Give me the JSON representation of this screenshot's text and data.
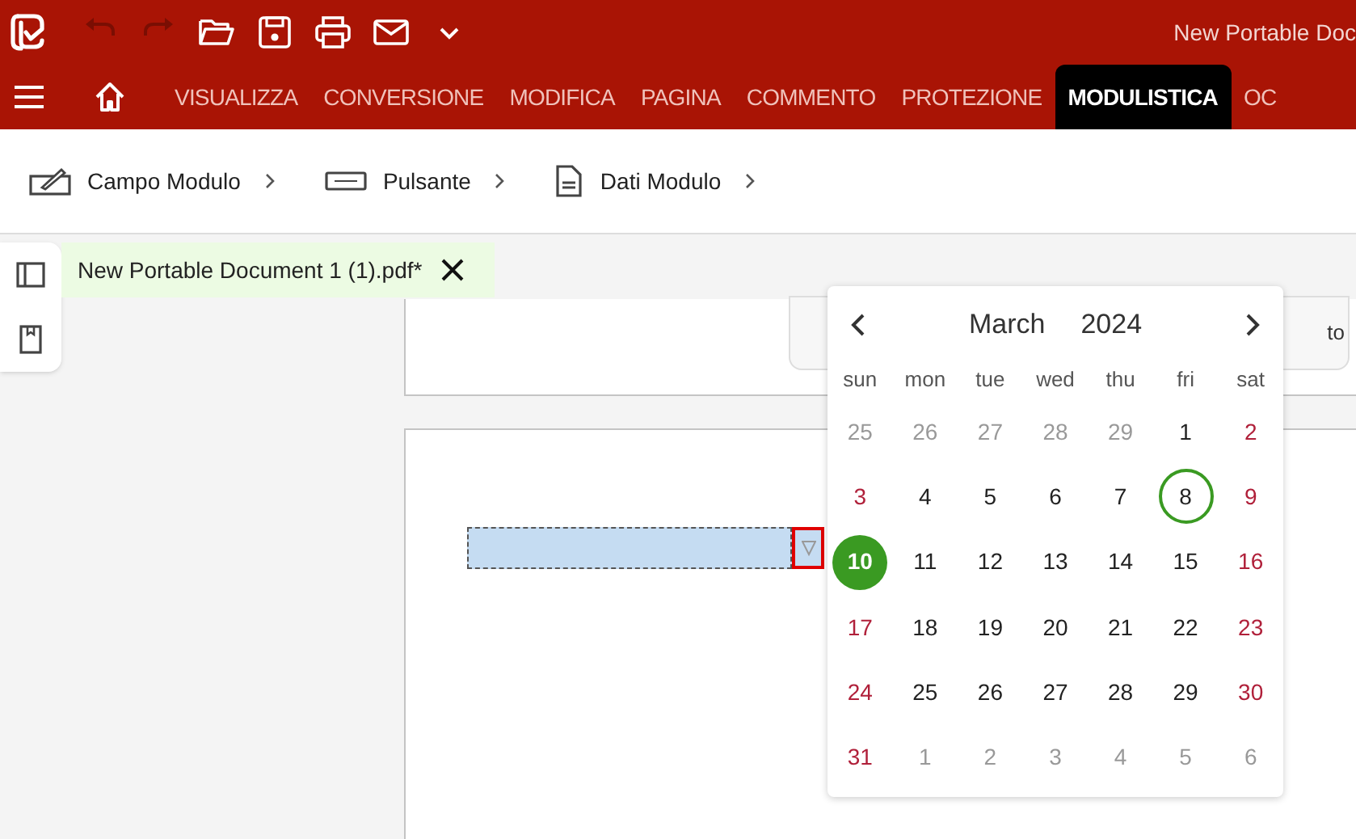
{
  "title_bar": {
    "title": "New Portable Doc",
    "quick_actions": [
      {
        "kind": "undo",
        "disabled": true
      },
      {
        "kind": "redo",
        "disabled": true
      },
      {
        "kind": "open",
        "disabled": false
      },
      {
        "kind": "save",
        "disabled": false
      },
      {
        "kind": "print",
        "disabled": false
      },
      {
        "kind": "mail",
        "disabled": false
      },
      {
        "kind": "more",
        "disabled": false
      }
    ]
  },
  "menu_tabs": [
    {
      "label": "VISUALIZZA",
      "selected": false
    },
    {
      "label": "CONVERSIONE",
      "selected": false
    },
    {
      "label": "MODIFICA",
      "selected": false
    },
    {
      "label": "PAGINA",
      "selected": false
    },
    {
      "label": "COMMENTO",
      "selected": false
    },
    {
      "label": "PROTEZIONE",
      "selected": false
    },
    {
      "label": "MODULISTICA",
      "selected": true
    },
    {
      "label": "OC",
      "selected": false
    }
  ],
  "ribbon": [
    {
      "label": "Campo Modulo",
      "kind": "field"
    },
    {
      "label": "Pulsante",
      "kind": "button"
    },
    {
      "label": "Dati Modulo",
      "kind": "data"
    }
  ],
  "document_tab": {
    "label": "New Portable Document 1 (1).pdf*"
  },
  "page_button_text": "to",
  "calendar": {
    "month": "March",
    "year": "2024",
    "weekdays": [
      "sun",
      "mon",
      "tue",
      "wed",
      "thu",
      "fri",
      "sat"
    ],
    "days": [
      {
        "label": "25",
        "kind": "other-month",
        "today": false,
        "selected": false
      },
      {
        "label": "26",
        "kind": "other-month",
        "today": false,
        "selected": false
      },
      {
        "label": "27",
        "kind": "other-month",
        "today": false,
        "selected": false
      },
      {
        "label": "28",
        "kind": "other-month",
        "today": false,
        "selected": false
      },
      {
        "label": "29",
        "kind": "other-month",
        "today": false,
        "selected": false
      },
      {
        "label": "1",
        "kind": "weekday",
        "today": false,
        "selected": false
      },
      {
        "label": "2",
        "kind": "weekend",
        "today": false,
        "selected": false
      },
      {
        "label": "3",
        "kind": "weekend",
        "today": false,
        "selected": false
      },
      {
        "label": "4",
        "kind": "weekday",
        "today": false,
        "selected": false
      },
      {
        "label": "5",
        "kind": "weekday",
        "today": false,
        "selected": false
      },
      {
        "label": "6",
        "kind": "weekday",
        "today": false,
        "selected": false
      },
      {
        "label": "7",
        "kind": "weekday",
        "today": false,
        "selected": false
      },
      {
        "label": "8",
        "kind": "weekday",
        "today": true,
        "selected": false
      },
      {
        "label": "9",
        "kind": "weekend",
        "today": false,
        "selected": false
      },
      {
        "label": "10",
        "kind": "weekend",
        "today": false,
        "selected": true
      },
      {
        "label": "11",
        "kind": "weekday",
        "today": false,
        "selected": false
      },
      {
        "label": "12",
        "kind": "weekday",
        "today": false,
        "selected": false
      },
      {
        "label": "13",
        "kind": "weekday",
        "today": false,
        "selected": false
      },
      {
        "label": "14",
        "kind": "weekday",
        "today": false,
        "selected": false
      },
      {
        "label": "15",
        "kind": "weekday",
        "today": false,
        "selected": false
      },
      {
        "label": "16",
        "kind": "weekend",
        "today": false,
        "selected": false
      },
      {
        "label": "17",
        "kind": "weekend",
        "today": false,
        "selected": false
      },
      {
        "label": "18",
        "kind": "weekday",
        "today": false,
        "selected": false
      },
      {
        "label": "19",
        "kind": "weekday",
        "today": false,
        "selected": false
      },
      {
        "label": "20",
        "kind": "weekday",
        "today": false,
        "selected": false
      },
      {
        "label": "21",
        "kind": "weekday",
        "today": false,
        "selected": false
      },
      {
        "label": "22",
        "kind": "weekday",
        "today": false,
        "selected": false
      },
      {
        "label": "23",
        "kind": "weekend",
        "today": false,
        "selected": false
      },
      {
        "label": "24",
        "kind": "weekend",
        "today": false,
        "selected": false
      },
      {
        "label": "25",
        "kind": "weekday",
        "today": false,
        "selected": false
      },
      {
        "label": "26",
        "kind": "weekday",
        "today": false,
        "selected": false
      },
      {
        "label": "27",
        "kind": "weekday",
        "today": false,
        "selected": false
      },
      {
        "label": "28",
        "kind": "weekday",
        "today": false,
        "selected": false
      },
      {
        "label": "29",
        "kind": "weekday",
        "today": false,
        "selected": false
      },
      {
        "label": "30",
        "kind": "weekend",
        "today": false,
        "selected": false
      },
      {
        "label": "31",
        "kind": "weekend",
        "today": false,
        "selected": false
      },
      {
        "label": "1",
        "kind": "other-month",
        "today": false,
        "selected": false
      },
      {
        "label": "2",
        "kind": "other-month",
        "today": false,
        "selected": false
      },
      {
        "label": "3",
        "kind": "other-month",
        "today": false,
        "selected": false
      },
      {
        "label": "4",
        "kind": "other-month",
        "today": false,
        "selected": false
      },
      {
        "label": "5",
        "kind": "other-month",
        "today": false,
        "selected": false
      },
      {
        "label": "6",
        "kind": "other-month",
        "today": false,
        "selected": false
      }
    ]
  }
}
